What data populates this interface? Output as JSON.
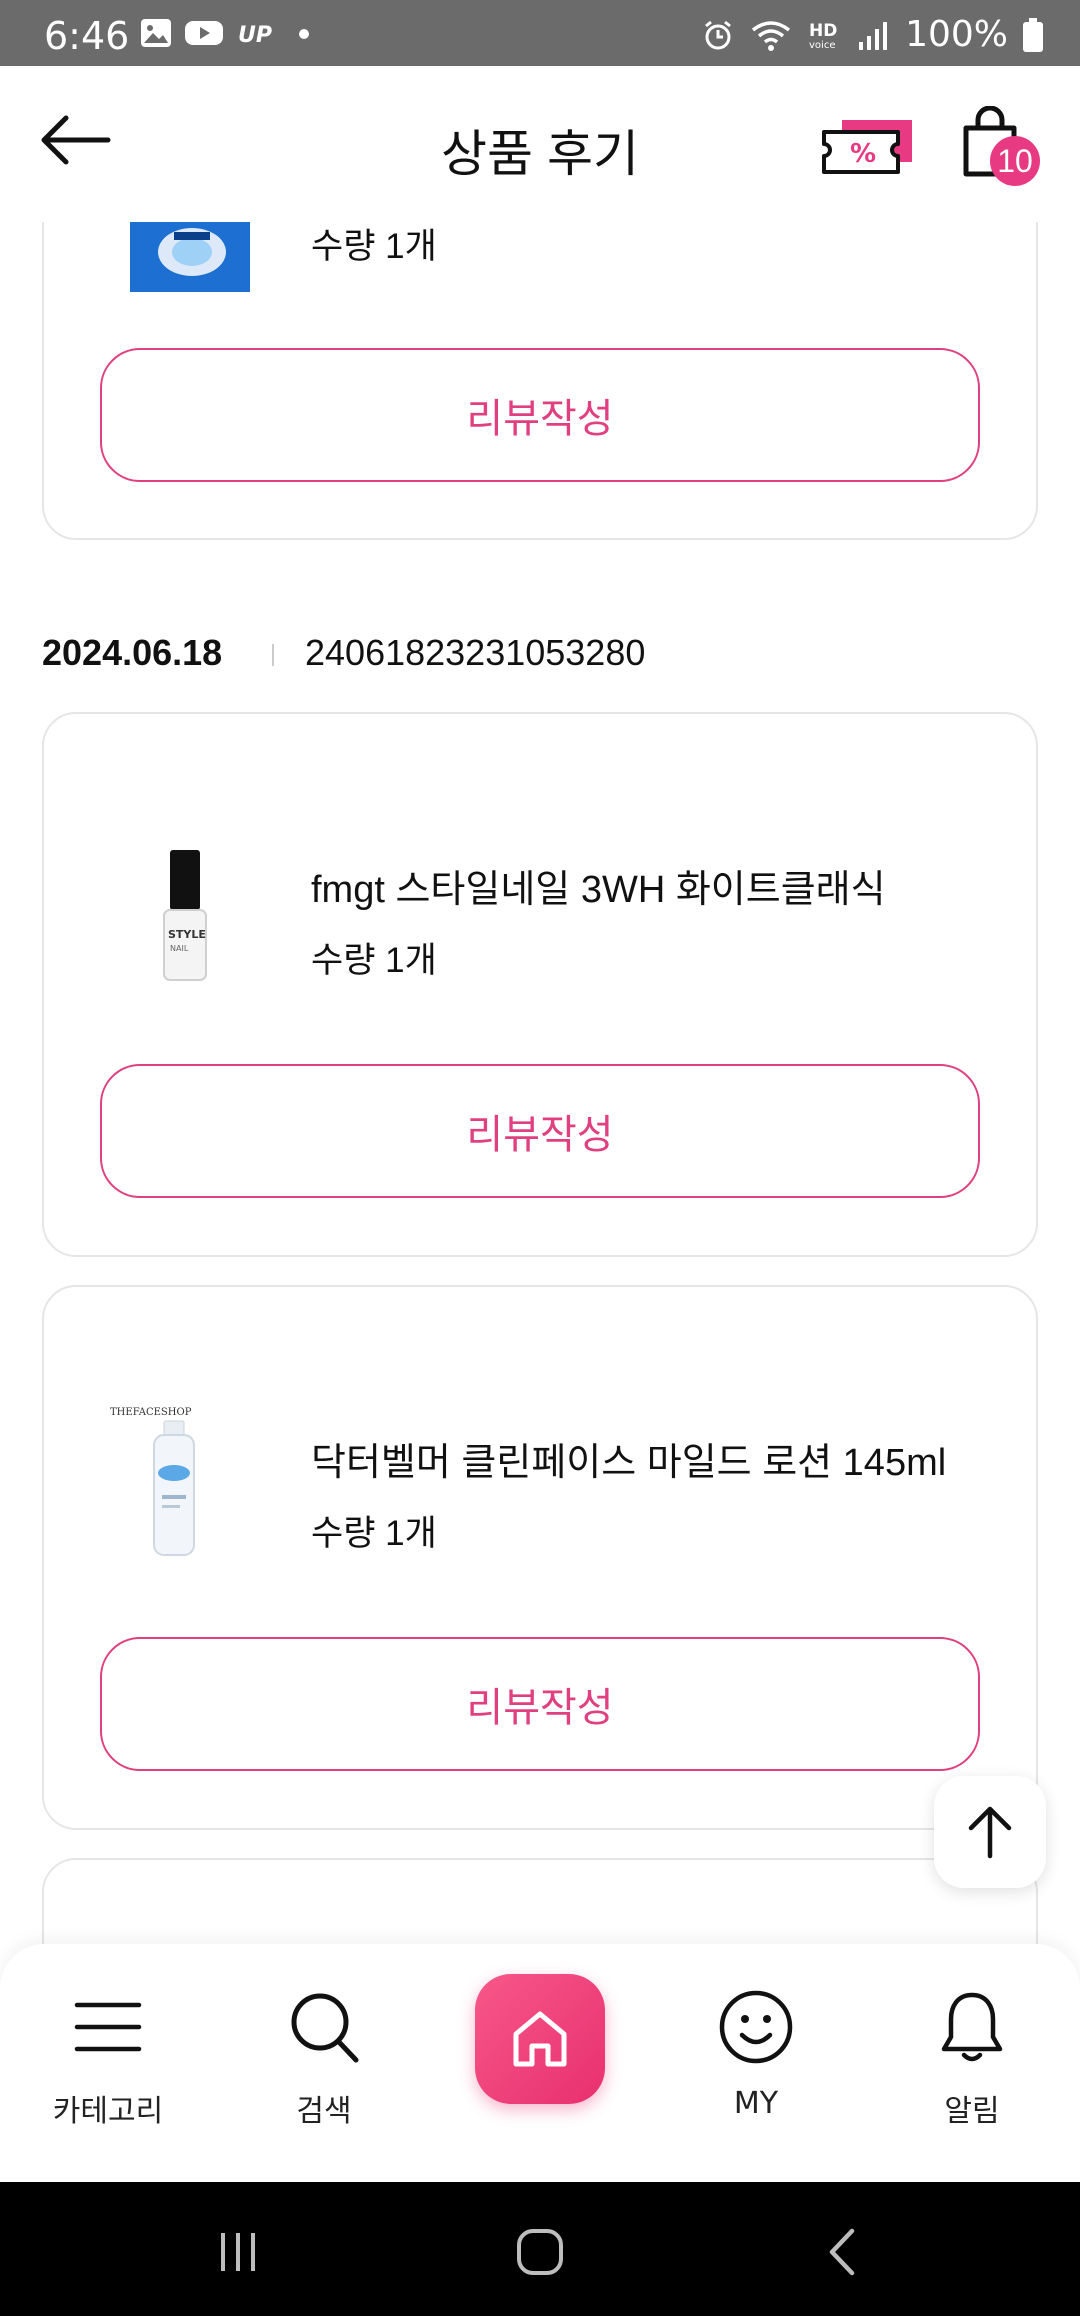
{
  "status_bar": {
    "time": "6:46",
    "battery": "100%"
  },
  "header": {
    "title": "상품 후기",
    "cart_count": "10"
  },
  "cards": [
    {
      "quantity": "수량 1개",
      "review_label": "리뷰작성"
    },
    {
      "product_name": "fmgt 스타일네일 3WH 화이트클래식",
      "quantity": "수량 1개",
      "review_label": "리뷰작성"
    },
    {
      "product_name": "닥터벨머 클린페이스 마일드 로션 145ml",
      "quantity": "수량 1개",
      "review_label": "리뷰작성"
    }
  ],
  "order": {
    "date": "2024.06.18",
    "number": "24061823231053280"
  },
  "bottom_nav": {
    "items": [
      {
        "label": "카테고리",
        "icon": "menu-icon"
      },
      {
        "label": "검색",
        "icon": "search-icon"
      },
      {
        "label": "",
        "icon": "home-icon"
      },
      {
        "label": "MY",
        "icon": "smiley-icon"
      },
      {
        "label": "알림",
        "icon": "bell-icon"
      }
    ]
  },
  "colors": {
    "accent": "#e0407f",
    "status_bar": "#6b6b6b"
  }
}
